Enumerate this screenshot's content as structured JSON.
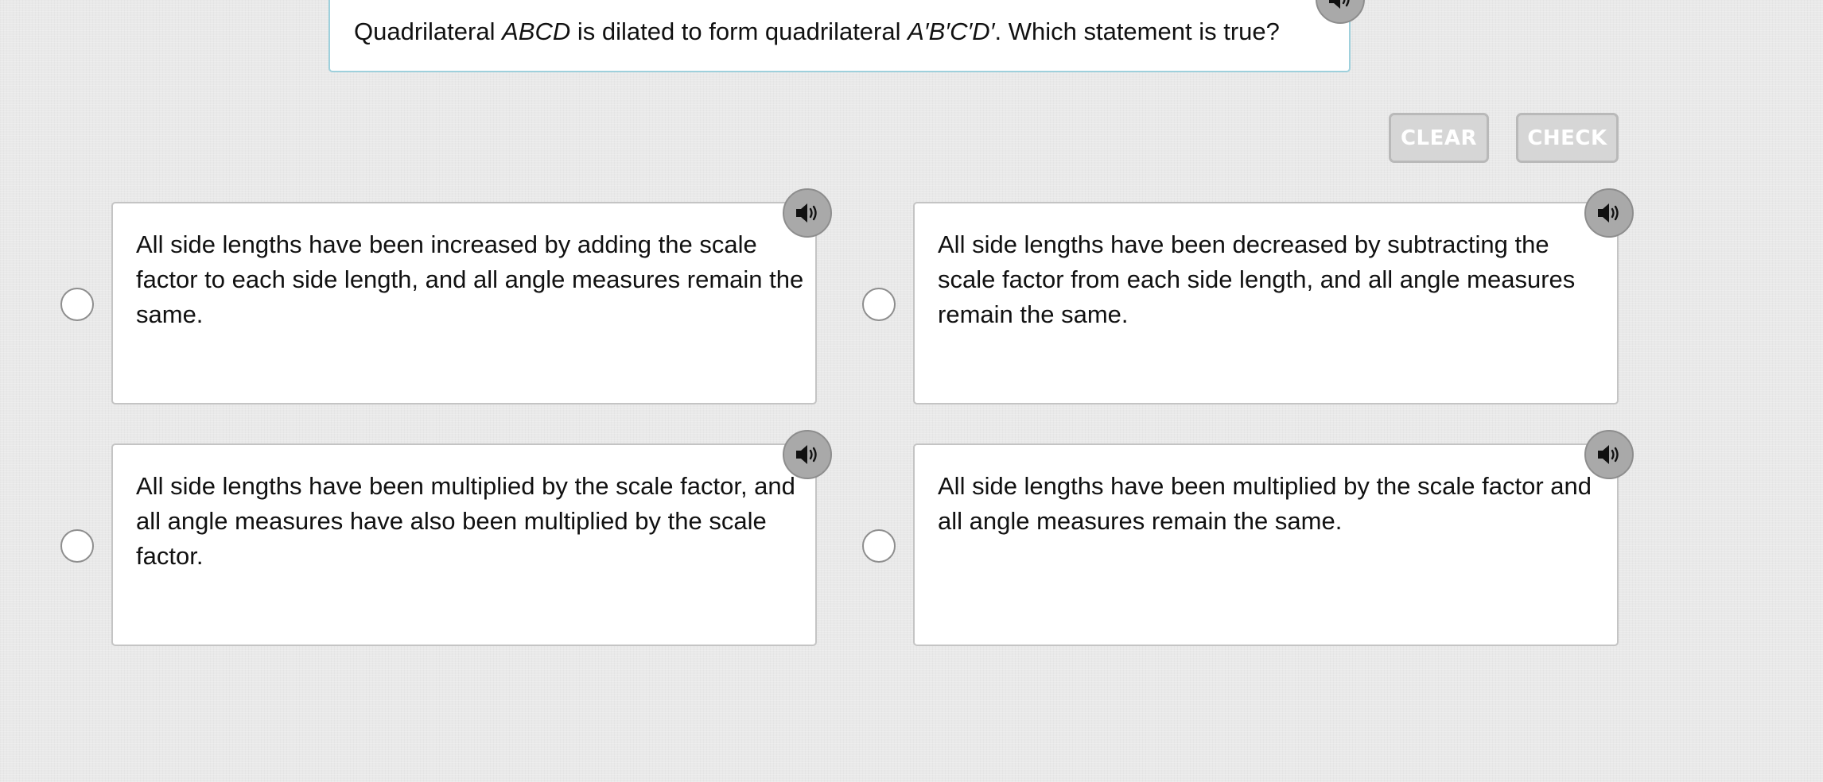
{
  "question": {
    "prefix": "Quadrilateral ",
    "shape_original": "ABCD",
    "middle": " is dilated to form quadrilateral ",
    "shape_image": "A′B′C′D′",
    "suffix": ". Which statement is true?",
    "audio_icon": "speaker-icon"
  },
  "actions": {
    "clear_label": "CLEAR",
    "check_label": "CHECK"
  },
  "choices": [
    {
      "text": "All side lengths have been increased by adding the scale factor to each side length, and all angle measures remain the same.",
      "selected": false,
      "audio_icon": "speaker-icon"
    },
    {
      "text": "All side lengths have been decreased by subtracting the scale factor from each side length, and all angle measures remain the same.",
      "selected": false,
      "audio_icon": "speaker-icon"
    },
    {
      "text": "All side lengths have been multiplied by the scale factor, and all angle measures have also been multiplied by the scale factor.",
      "selected": false,
      "audio_icon": "speaker-icon"
    },
    {
      "text": "All side lengths have been multiplied by the scale factor and all angle measures remain the same.",
      "selected": false,
      "audio_icon": "speaker-icon"
    }
  ],
  "colors": {
    "background": "#e9e9e9",
    "prompt_border": "#9ed0dc",
    "audio_button": "#a9a9a9",
    "disabled_button": "#d6d6d6"
  }
}
